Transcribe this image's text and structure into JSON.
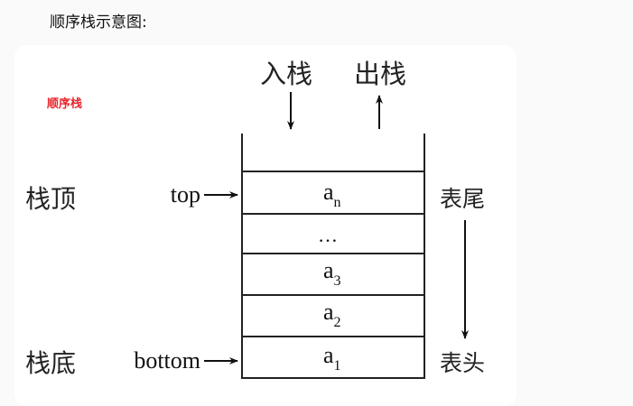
{
  "heading": "顺序栈示意图:",
  "diagram": {
    "tag": "顺序栈",
    "push_label": "入栈",
    "pop_label": "出栈",
    "top_side_label": "栈顶",
    "bottom_side_label": "栈底",
    "top_pointer": "top",
    "bottom_pointer": "bottom",
    "tail_label": "表尾",
    "head_label": "表头",
    "cells": [
      {
        "base": "a",
        "sub": "n"
      },
      {
        "base": "…",
        "sub": ""
      },
      {
        "base": "a",
        "sub": "3"
      },
      {
        "base": "a",
        "sub": "2"
      },
      {
        "base": "a",
        "sub": "1"
      }
    ]
  }
}
